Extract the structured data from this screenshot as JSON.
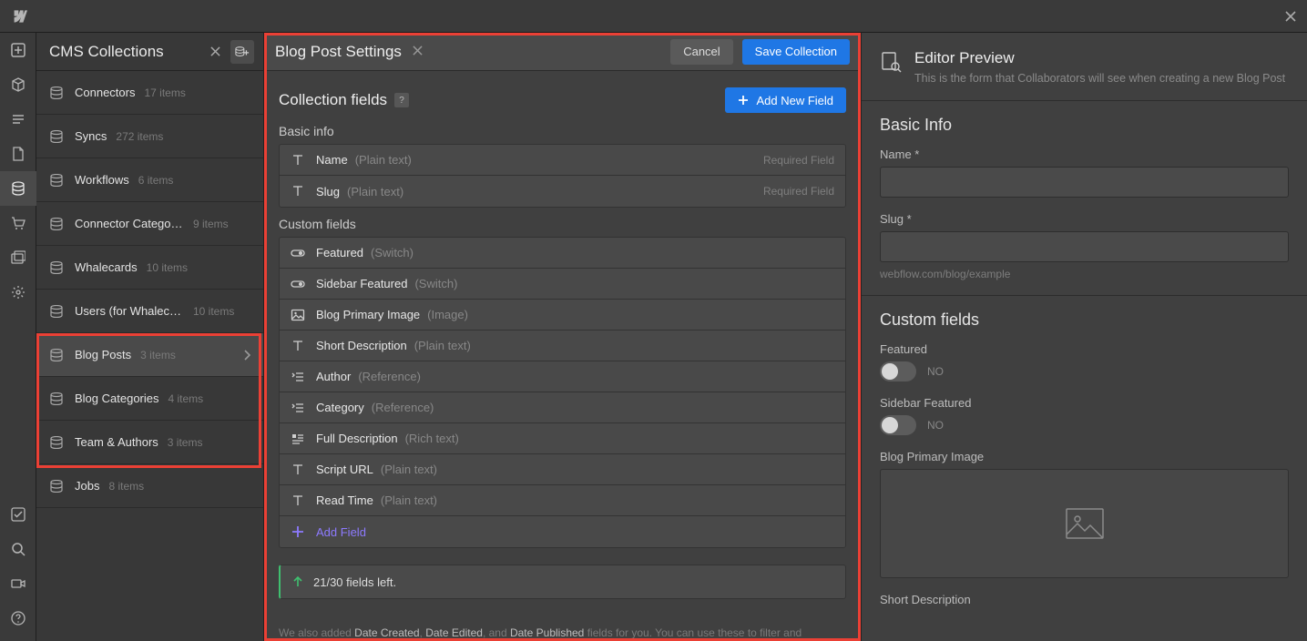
{
  "sidebar": {
    "title": "CMS Collections",
    "items": [
      {
        "name": "Connectors",
        "count": "17 items"
      },
      {
        "name": "Syncs",
        "count": "272 items"
      },
      {
        "name": "Workflows",
        "count": "6 items"
      },
      {
        "name": "Connector Categories",
        "count": "9 items"
      },
      {
        "name": "Whalecards",
        "count": "10 items"
      },
      {
        "name": "Users (for Whalecar...",
        "count": "10 items"
      },
      {
        "name": "Blog Posts",
        "count": "3 items"
      },
      {
        "name": "Blog Categories",
        "count": "4 items"
      },
      {
        "name": "Team & Authors",
        "count": "3 items"
      },
      {
        "name": "Jobs",
        "count": "8 items"
      }
    ]
  },
  "settings": {
    "title": "Blog Post Settings",
    "cancel": "Cancel",
    "save": "Save Collection",
    "collection_fields": "Collection fields",
    "add_new_field": "Add New Field",
    "basic_label": "Basic info",
    "custom_label": "Custom fields",
    "basic_fields": [
      {
        "icon": "text",
        "name": "Name",
        "type": "(Plain text)",
        "required": "Required Field"
      },
      {
        "icon": "text",
        "name": "Slug",
        "type": "(Plain text)",
        "required": "Required Field"
      }
    ],
    "custom_fields": [
      {
        "icon": "switch",
        "name": "Featured",
        "type": "(Switch)"
      },
      {
        "icon": "switch",
        "name": "Sidebar Featured",
        "type": "(Switch)"
      },
      {
        "icon": "image",
        "name": "Blog Primary Image",
        "type": "(Image)"
      },
      {
        "icon": "text",
        "name": "Short Description",
        "type": "(Plain text)"
      },
      {
        "icon": "ref",
        "name": "Author",
        "type": "(Reference)"
      },
      {
        "icon": "ref",
        "name": "Category",
        "type": "(Reference)"
      },
      {
        "icon": "rich",
        "name": "Full Description",
        "type": "(Rich text)"
      },
      {
        "icon": "text",
        "name": "Script URL",
        "type": "(Plain text)"
      },
      {
        "icon": "text",
        "name": "Read Time",
        "type": "(Plain text)"
      }
    ],
    "add_field": "Add Field",
    "counter": "21/30 fields left.",
    "footnote_pre": "We also added ",
    "footnote_dc": "Date Created",
    "footnote_de": "Date Edited",
    "footnote_and": ", and ",
    "footnote_dp": "Date Published",
    "footnote_post": " fields for you. You can use these to filter and"
  },
  "preview": {
    "title": "Editor Preview",
    "subtitle": "This is the form that Collaborators will see when creating a new Blog Post",
    "basic_info": "Basic Info",
    "name_label": "Name *",
    "slug_label": "Slug *",
    "slug_hint": "webflow.com/blog/example",
    "custom_fields": "Custom fields",
    "featured_label": "Featured",
    "sidebar_featured_label": "Sidebar Featured",
    "toggle_off": "NO",
    "image_label": "Blog Primary Image",
    "short_desc_label": "Short Description"
  }
}
